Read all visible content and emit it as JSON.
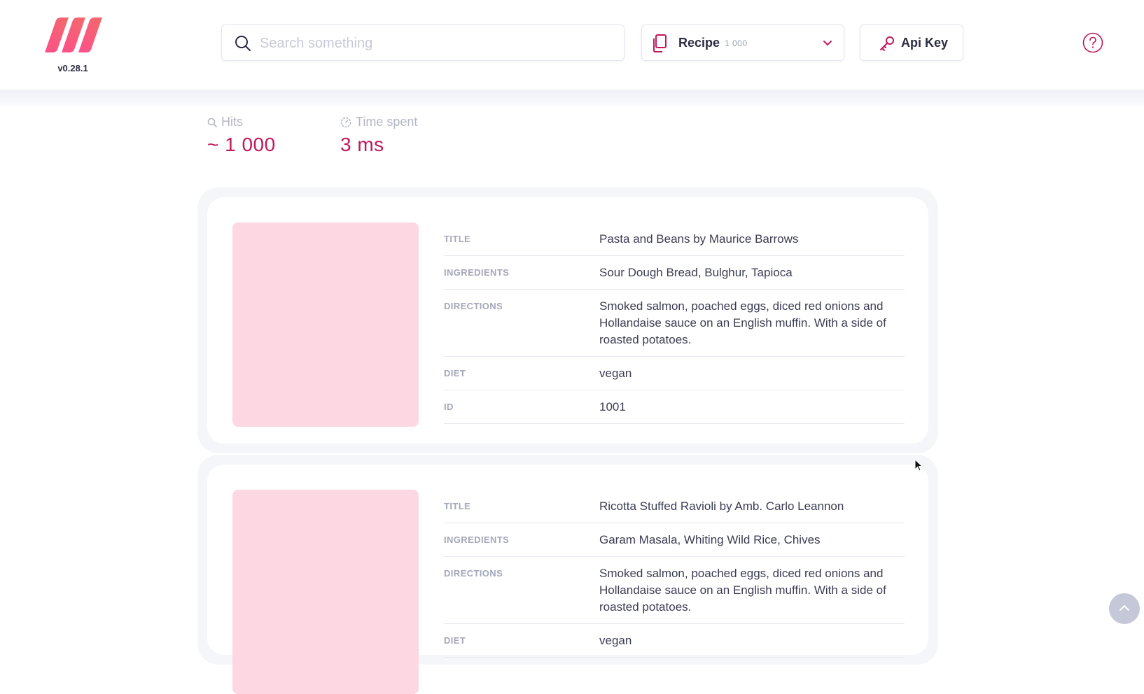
{
  "app": {
    "version": "v0.28.1",
    "brand_color": "#f2557b"
  },
  "header": {
    "search": {
      "placeholder": "Search something",
      "value": ""
    },
    "index_selector": {
      "name": "Recipe",
      "count": "1 000"
    },
    "api_key_label": "Api Key"
  },
  "stats": {
    "hits_label": "Hits",
    "hits_value": "~ 1 000",
    "time_label": "Time spent",
    "time_value": "3 ms",
    "value_color": "#c2185b"
  },
  "results": [
    {
      "image_placeholder_color": "#fdd7e2",
      "fields": [
        {
          "key": "TITLE",
          "value": "Pasta and Beans by Maurice Barrows"
        },
        {
          "key": "INGREDIENTS",
          "value": "Sour Dough Bread, Bulghur, Tapioca"
        },
        {
          "key": "DIRECTIONS",
          "value": "Smoked salmon, poached eggs, diced red onions and Hollandaise sauce on an English muffin. With a side of roasted potatoes."
        },
        {
          "key": "DIET",
          "value": "vegan"
        },
        {
          "key": "ID",
          "value": "1001"
        }
      ]
    },
    {
      "image_placeholder_color": "#fdd7e2",
      "fields": [
        {
          "key": "TITLE",
          "value": "Ricotta Stuffed Ravioli by Amb. Carlo Leannon"
        },
        {
          "key": "INGREDIENTS",
          "value": "Garam Masala, Whiting Wild Rice, Chives"
        },
        {
          "key": "DIRECTIONS",
          "value": "Smoked salmon, poached eggs, diced red onions and Hollandaise sauce on an English muffin. With a side of roasted potatoes."
        },
        {
          "key": "DIET",
          "value": "vegan"
        }
      ]
    }
  ],
  "icons": {
    "logo": "meilisearch-logo",
    "search": "search-icon",
    "index": "document-icon",
    "dropdown": "chevron-down-icon",
    "api_key": "key-icon",
    "help": "help-circle-icon",
    "scroll_top": "chevron-up-icon"
  }
}
